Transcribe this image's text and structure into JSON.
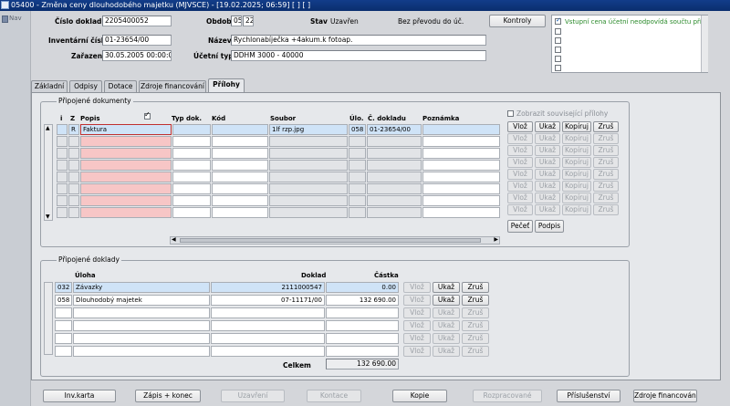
{
  "window": {
    "title": "05400 - Změna ceny dlouhodobého majetku (MJVSCE) - [19.02.2025; 06:59]  [  ]  [  ]"
  },
  "nav": {
    "label": "Nav"
  },
  "header": {
    "cislo_dokladu_label": "Číslo dokladu",
    "cislo_dokladu_value": "2205400052",
    "obdobi_label": "Období",
    "obdobi_month": "05",
    "obdobi_year": "22",
    "stav_label": "Stav",
    "stav_value": "Uzavřen",
    "prevod_text": "Bez převodu do úč.",
    "kontroly_label": "Kontroly",
    "inventarni_cislo_label": "Inventární číslo",
    "inventarni_cislo_value": "01-23654/00",
    "nazev_label": "Název",
    "nazev_value": "Rychlonabíječka +4akum.k fotoap.",
    "zarazen_label": "Zařazen",
    "zarazen_value": "30.05.2005 00:00:00",
    "ucetni_typ_label": "Účetní typ",
    "ucetni_typ_value": "DDHM 3000 - 40000"
  },
  "warnings": {
    "first_text": "Vstupní cena účetní neodpovídá součtu příp",
    "first_checked": true,
    "rows": 6
  },
  "tabs": [
    {
      "label": "Základní",
      "active": false
    },
    {
      "label": "Odpisy",
      "active": false
    },
    {
      "label": "Dotace",
      "active": false
    },
    {
      "label": "Zdroje financování",
      "active": false
    },
    {
      "label": "Přílohy",
      "active": true
    }
  ],
  "docs": {
    "group_title": "Připojené dokumenty",
    "headers": {
      "i": "i",
      "z": "Z",
      "popis": "Popis",
      "typ": "Typ dok.",
      "kod": "Kód",
      "soubor": "Soubor",
      "ulo": "Úlo.",
      "cdokladu": "Č. dokladu",
      "poznamka": "Poznámka"
    },
    "popis_check": true,
    "show_related_label": "Zobrazit související přílohy",
    "rows": [
      {
        "i": "",
        "z": "R",
        "popis": "Faktura",
        "typ": "",
        "kod": "",
        "soubor": "1lf rzp.jpg",
        "ulo": "058",
        "cdokladu": "01-23654/00",
        "poznamka": ""
      },
      {
        "i": "",
        "z": "",
        "popis": "",
        "typ": "",
        "kod": "",
        "soubor": "",
        "ulo": "",
        "cdokladu": "",
        "poznamka": ""
      },
      {
        "i": "",
        "z": "",
        "popis": "",
        "typ": "",
        "kod": "",
        "soubor": "",
        "ulo": "",
        "cdokladu": "",
        "poznamka": ""
      },
      {
        "i": "",
        "z": "",
        "popis": "",
        "typ": "",
        "kod": "",
        "soubor": "",
        "ulo": "",
        "cdokladu": "",
        "poznamka": ""
      },
      {
        "i": "",
        "z": "",
        "popis": "",
        "typ": "",
        "kod": "",
        "soubor": "",
        "ulo": "",
        "cdokladu": "",
        "poznamka": ""
      },
      {
        "i": "",
        "z": "",
        "popis": "",
        "typ": "",
        "kod": "",
        "soubor": "",
        "ulo": "",
        "cdokladu": "",
        "poznamka": ""
      },
      {
        "i": "",
        "z": "",
        "popis": "",
        "typ": "",
        "kod": "",
        "soubor": "",
        "ulo": "",
        "cdokladu": "",
        "poznamka": ""
      },
      {
        "i": "",
        "z": "",
        "popis": "",
        "typ": "",
        "kod": "",
        "soubor": "",
        "ulo": "",
        "cdokladu": "",
        "poznamka": ""
      }
    ],
    "row_buttons": [
      {
        "vloz": "Vlož",
        "ukaz": "Ukaž",
        "kopiruj": "Kopíruj",
        "zrus": "Zruš",
        "enabled": true
      },
      {
        "vloz": "Vlož",
        "ukaz": "Ukaž",
        "kopiruj": "Kopíruj",
        "zrus": "Zruš",
        "enabled": false
      },
      {
        "vloz": "Vlož",
        "ukaz": "Ukaž",
        "kopiruj": "Kopíruj",
        "zrus": "Zruš",
        "enabled": false
      },
      {
        "vloz": "Vlož",
        "ukaz": "Ukaž",
        "kopiruj": "Kopíruj",
        "zrus": "Zruš",
        "enabled": false
      },
      {
        "vloz": "Vlož",
        "ukaz": "Ukaž",
        "kopiruj": "Kopíruj",
        "zrus": "Zruš",
        "enabled": false
      },
      {
        "vloz": "Vlož",
        "ukaz": "Ukaž",
        "kopiruj": "Kopíruj",
        "zrus": "Zruš",
        "enabled": false
      },
      {
        "vloz": "Vlož",
        "ukaz": "Ukaž",
        "kopiruj": "Kopíruj",
        "zrus": "Zruš",
        "enabled": false
      },
      {
        "vloz": "Vlož",
        "ukaz": "Ukaž",
        "kopiruj": "Kopíruj",
        "zrus": "Zruš",
        "enabled": false
      }
    ],
    "pecet_label": "Pečeť",
    "podpis_label": "Podpis"
  },
  "linked": {
    "group_title": "Připojené doklady",
    "headers": {
      "uloha": "Úloha",
      "doklad": "Doklad",
      "castka": "Částka"
    },
    "rows": [
      {
        "code": "032",
        "name": "Závazky",
        "doklad": "2111000547",
        "castka": "0.00"
      },
      {
        "code": "058",
        "name": "Dlouhodobý majetek",
        "doklad": "07-11171/00",
        "castka": "132 690.00"
      },
      {
        "code": "",
        "name": "",
        "doklad": "",
        "castka": ""
      },
      {
        "code": "",
        "name": "",
        "doklad": "",
        "castka": ""
      },
      {
        "code": "",
        "name": "",
        "doklad": "",
        "castka": ""
      },
      {
        "code": "",
        "name": "",
        "doklad": "",
        "castka": ""
      }
    ],
    "row_buttons": [
      {
        "vloz": "Vlož",
        "ukaz": "Ukaž",
        "zrus": "Zruš",
        "ukaz_enabled": true,
        "zrus_enabled": true
      },
      {
        "vloz": "Vlož",
        "ukaz": "Ukaž",
        "zrus": "Zruš",
        "ukaz_enabled": true,
        "zrus_enabled": true
      },
      {
        "vloz": "Vlož",
        "ukaz": "Ukaž",
        "zrus": "Zruš",
        "ukaz_enabled": false,
        "zrus_enabled": false
      },
      {
        "vloz": "Vlož",
        "ukaz": "Ukaž",
        "zrus": "Zruš",
        "ukaz_enabled": false,
        "zrus_enabled": false
      },
      {
        "vloz": "Vlož",
        "ukaz": "Ukaž",
        "zrus": "Zruš",
        "ukaz_enabled": false,
        "zrus_enabled": false
      },
      {
        "vloz": "Vlož",
        "ukaz": "Ukaž",
        "zrus": "Zruš",
        "ukaz_enabled": false,
        "zrus_enabled": false
      }
    ],
    "celkem_label": "Celkem",
    "celkem_value": "132 690.00"
  },
  "footer": [
    {
      "label": "Inv.karta",
      "enabled": true
    },
    {
      "label": "Zápis + konec",
      "enabled": true
    },
    {
      "label": "Uzavření",
      "enabled": false
    },
    {
      "label": "Kontace",
      "enabled": false
    },
    {
      "label": "Kopie",
      "enabled": true
    },
    {
      "label": "Rozpracované",
      "enabled": false
    },
    {
      "label": "Příslušenství",
      "enabled": true
    },
    {
      "label": "Zdroje financování",
      "enabled": true
    }
  ],
  "colors": {
    "titlebar": "#123d8a",
    "warning_text": "#2a8a2a",
    "required_cell": "#f7c6c6",
    "selected_row": "#cfe3f7"
  }
}
